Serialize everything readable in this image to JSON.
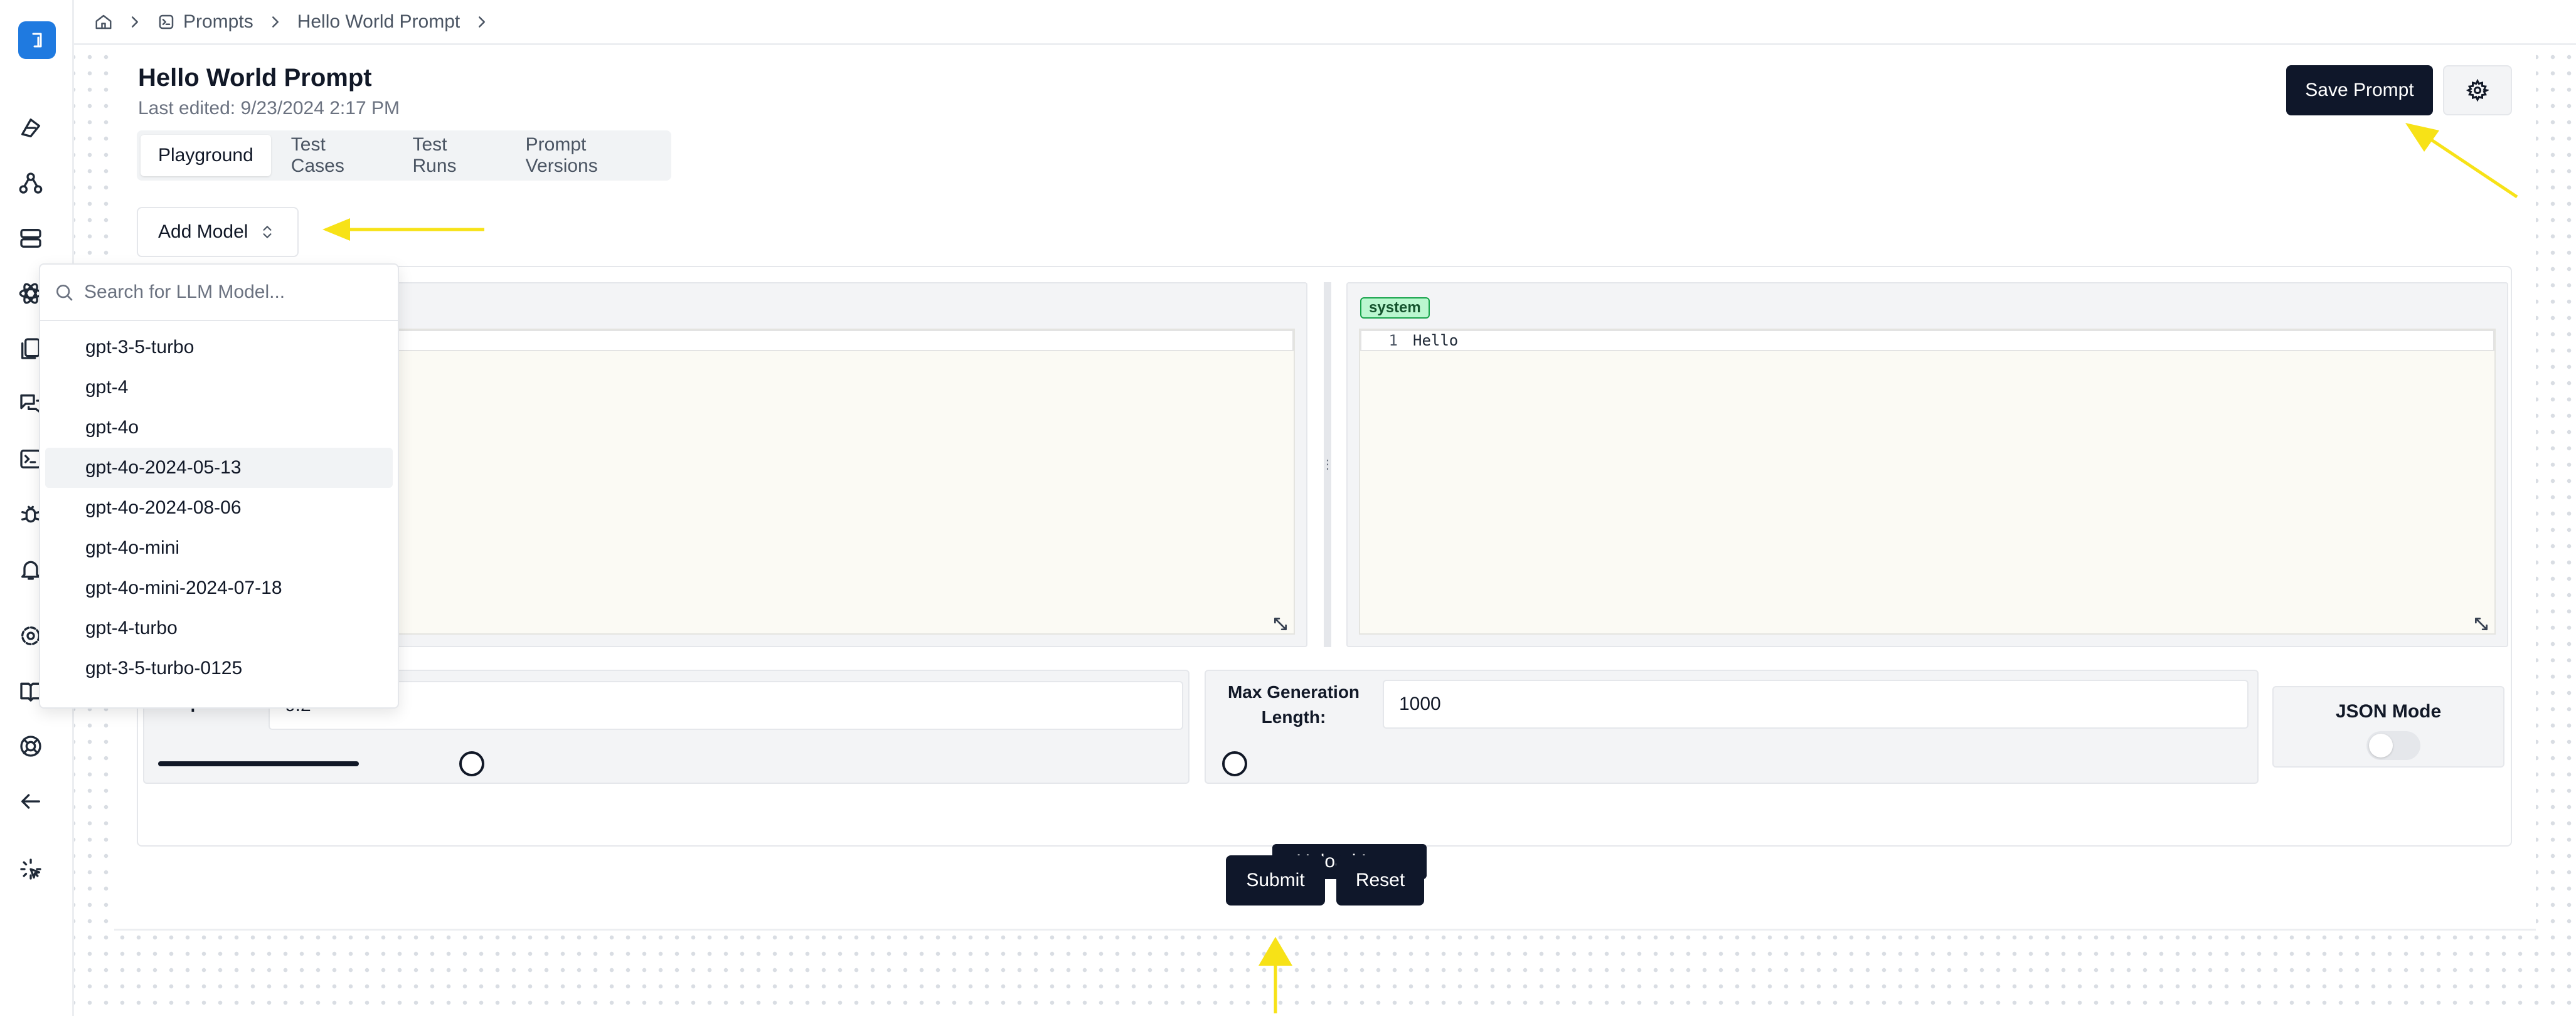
{
  "sidebar": {
    "icons": [
      "app-logo",
      "prompts-icon",
      "workflows-icon",
      "datasets-icon",
      "models-icon",
      "documents-icon",
      "chat-icon",
      "terminal-icon",
      "debug-icon",
      "alerts-icon",
      "settings-icon",
      "book-icon",
      "help-icon",
      "back-arrow-icon",
      "agent-icon"
    ]
  },
  "breadcrumb": {
    "home_icon": "home-icon",
    "items": [
      "Prompts",
      "Hello World Prompt"
    ]
  },
  "header": {
    "title": "Hello World Prompt",
    "last_edited": "Last edited: 9/23/2024 2:17 PM",
    "save_label": "Save Prompt",
    "settings_icon": "gear-icon"
  },
  "tabs": [
    {
      "label": "Playground",
      "active": true
    },
    {
      "label": "Test Cases",
      "active": false
    },
    {
      "label": "Test Runs",
      "active": false
    },
    {
      "label": "Prompt Versions",
      "active": false
    }
  ],
  "add_model": {
    "label": "Add Model",
    "search_placeholder": "Search for LLM Model...",
    "options": [
      "gpt-3-5-turbo",
      "gpt-4",
      "gpt-4o",
      "gpt-4o-2024-05-13",
      "gpt-4o-2024-08-06",
      "gpt-4o-mini",
      "gpt-4o-mini-2024-07-18",
      "gpt-4-turbo",
      "gpt-3-5-turbo-0125"
    ],
    "highlighted": "gpt-4o-2024-05-13"
  },
  "editor": {
    "role": "system",
    "line_number": "1",
    "line_text": "Hello"
  },
  "params": {
    "temperature_label": "Temperature:",
    "temperature_value": "0.2",
    "temperature_fraction": 0.2,
    "max_length_label": "Max Generation Length:",
    "max_length_value": "1000",
    "max_length_fraction": 0.0,
    "json_mode_label": "JSON Mode",
    "json_mode_on": false
  },
  "actions": {
    "upload_label": "+Upload Image",
    "submit_label": "Submit",
    "reset_label": "Reset"
  },
  "colors": {
    "primary_dark": "#0f172a",
    "badge_green": "#bbf7d0",
    "annotation_yellow": "#f7e217"
  }
}
